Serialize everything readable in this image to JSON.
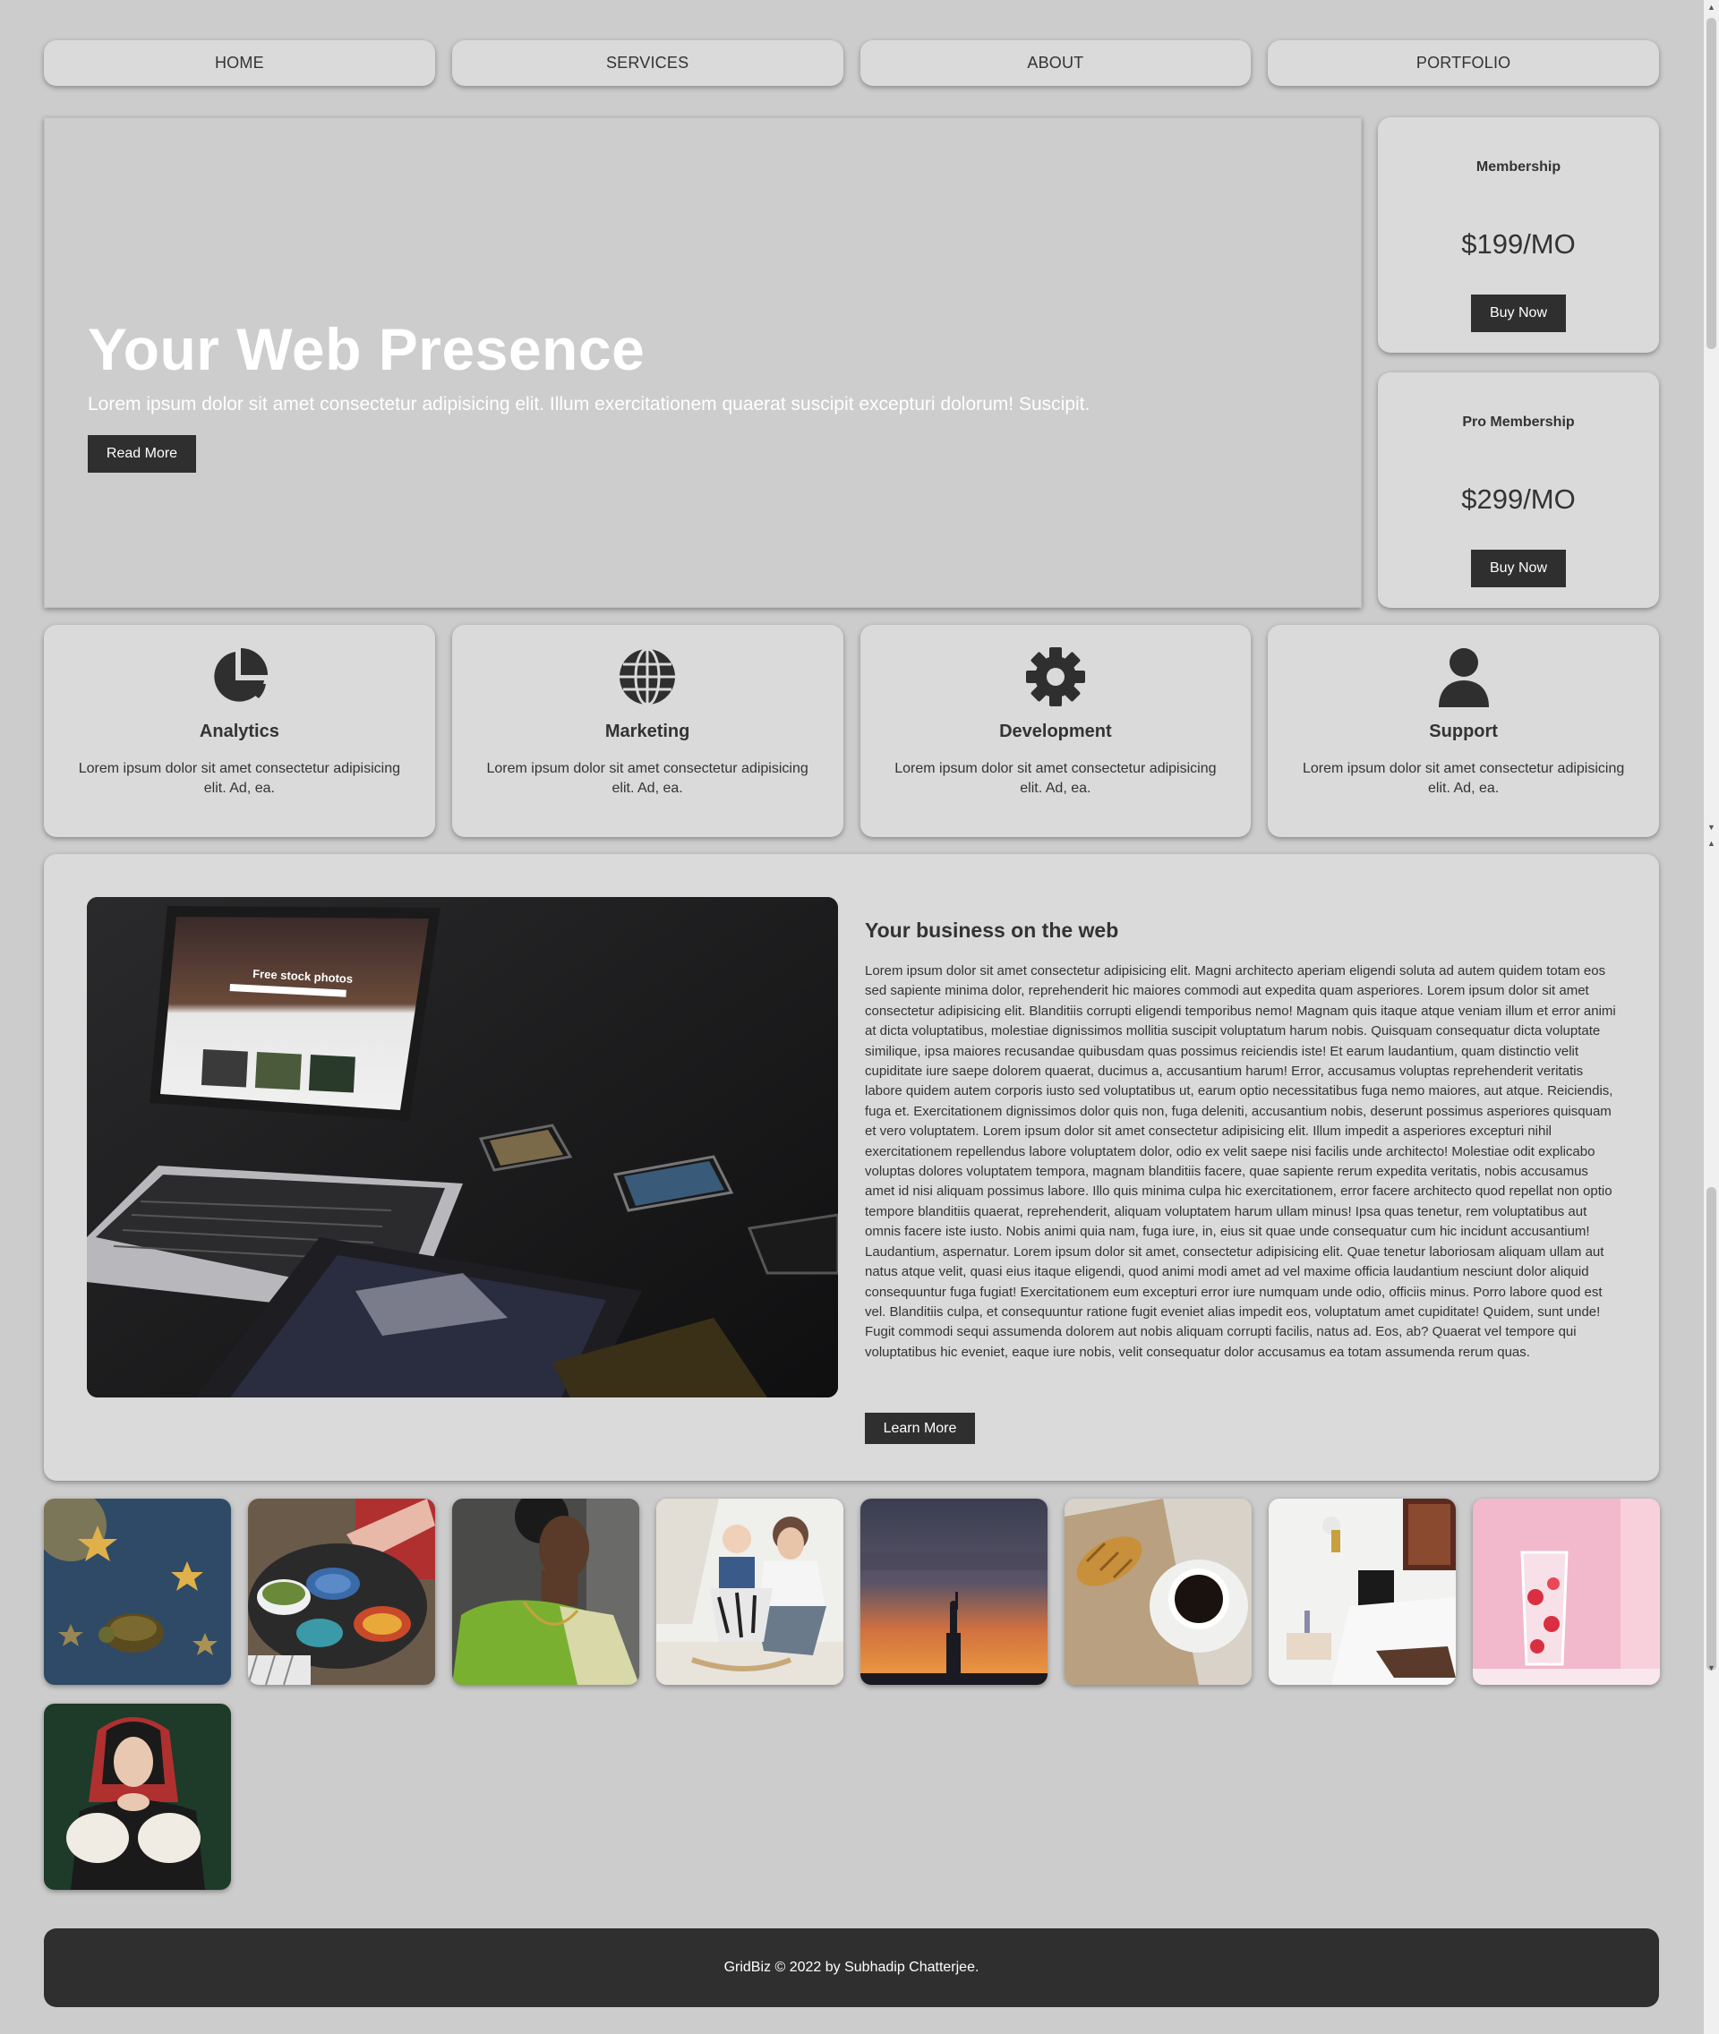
{
  "nav": {
    "items": [
      {
        "label": "HOME"
      },
      {
        "label": "SERVICES"
      },
      {
        "label": "ABOUT"
      },
      {
        "label": "PORTFOLIO"
      }
    ]
  },
  "hero": {
    "title": "Your Web Presence",
    "subtitle": "Lorem ipsum dolor sit amet consectetur adipisicing elit. Illum exercitationem quaerat suscipit excepturi dolorum! Suscipit.",
    "button": "Read More"
  },
  "pricing": [
    {
      "name": "Membership",
      "price": "$199/MO",
      "button": "Buy Now"
    },
    {
      "name": "Pro Membership",
      "price": "$299/MO",
      "button": "Buy Now"
    }
  ],
  "services": [
    {
      "icon": "pie-chart-icon",
      "title": "Analytics",
      "text": "Lorem ipsum dolor sit amet consectetur adipisicing elit. Ad, ea."
    },
    {
      "icon": "globe-icon",
      "title": "Marketing",
      "text": "Lorem ipsum dolor sit amet consectetur adipisicing elit. Ad, ea."
    },
    {
      "icon": "gear-icon",
      "title": "Development",
      "text": "Lorem ipsum dolor sit amet consectetur adipisicing elit. Ad, ea."
    },
    {
      "icon": "user-icon",
      "title": "Support",
      "text": "Lorem ipsum dolor sit amet consectetur adipisicing elit. Ad, ea."
    }
  ],
  "about": {
    "image_text": "Free stock photos",
    "title": "Your business on the web",
    "body": "Lorem ipsum dolor sit amet consectetur adipisicing elit. Magni architecto aperiam eligendi soluta ad autem quidem totam eos sed sapiente minima dolor, reprehenderit hic maiores commodi aut expedita quam asperiores. Lorem ipsum dolor sit amet consectetur adipisicing elit. Blanditiis corrupti eligendi temporibus nemo! Magnam quis itaque atque veniam illum et error animi at dicta voluptatibus, molestiae dignissimos mollitia suscipit voluptatum harum nobis. Quisquam consequatur dicta voluptate similique, ipsa maiores recusandae quibusdam quas possimus reiciendis iste! Et earum laudantium, quam distinctio velit cupiditate iure saepe dolorem quaerat, ducimus a, accusantium harum! Error, accusamus voluptas reprehenderit veritatis labore quidem autem corporis iusto sed voluptatibus ut, earum optio necessitatibus fuga nemo maiores, aut atque. Reiciendis, fuga et. Exercitationem dignissimos dolor quis non, fuga deleniti, accusantium nobis, deserunt possimus asperiores quisquam et vero voluptatem. Lorem ipsum dolor sit amet consectetur adipisicing elit. Illum impedit a asperiores excepturi nihil exercitationem repellendus labore voluptatem dolor, odio ex velit saepe nisi facilis unde architecto! Molestiae odit explicabo voluptas dolores voluptatem tempora, magnam blanditiis facere, quae sapiente rerum expedita veritatis, nobis accusamus amet id nisi aliquam possimus labore. Illo quis minima culpa hic exercitationem, error facere architecto quod repellat non optio tempore blanditiis quaerat, reprehenderit, aliquam voluptatem harum ullam minus! Ipsa quas tenetur, rem voluptatibus aut omnis facere iste iusto. Nobis animi quia nam, fuga iure, in, eius sit quae unde consequatur cum hic incidunt accusantium! Laudantium, aspernatur. Lorem ipsum dolor sit amet, consectetur adipisicing elit. Quae tenetur laboriosam aliquam ullam aut natus atque velit, quasi eius itaque eligendi, quod animi modi amet ad vel maxime officia laudantium nesciunt dolor aliquid consequuntur fuga fugiat! Exercitationem eum excepturi error iure numquam unde odio, officiis minus. Porro labore quod est vel. Blanditiis culpa, et consequuntur ratione fugit eveniet alias impedit eos, voluptatum amet cupiditate! Quidem, sunt unde! Fugit commodi sequi assumenda dolorem aut nobis aliquam corrupti facilis, natus ad. Eos, ab? Quaerat vel tempore qui voluptatibus hic eveniet, eaque iure nobis, velit consequatur dolor accusamus ea totam assumenda rerum quas.",
    "button": "Learn More"
  },
  "gallery": [
    {
      "name": "turtle-stars-photo"
    },
    {
      "name": "food-table-photo"
    },
    {
      "name": "woman-green-sari-photo"
    },
    {
      "name": "mother-child-photo"
    },
    {
      "name": "statue-liberty-sunset-photo"
    },
    {
      "name": "coffee-croissant-photo"
    },
    {
      "name": "bedroom-photo"
    },
    {
      "name": "pink-drink-photo"
    },
    {
      "name": "woman-portrait-photo"
    }
  ],
  "footer": {
    "text": "GridBiz © 2022 by Subhadip Chatterjee."
  },
  "colors": {
    "background": "#cccccc",
    "card": "#dadada",
    "button_dark": "#2f2f2f",
    "text": "#333333"
  }
}
